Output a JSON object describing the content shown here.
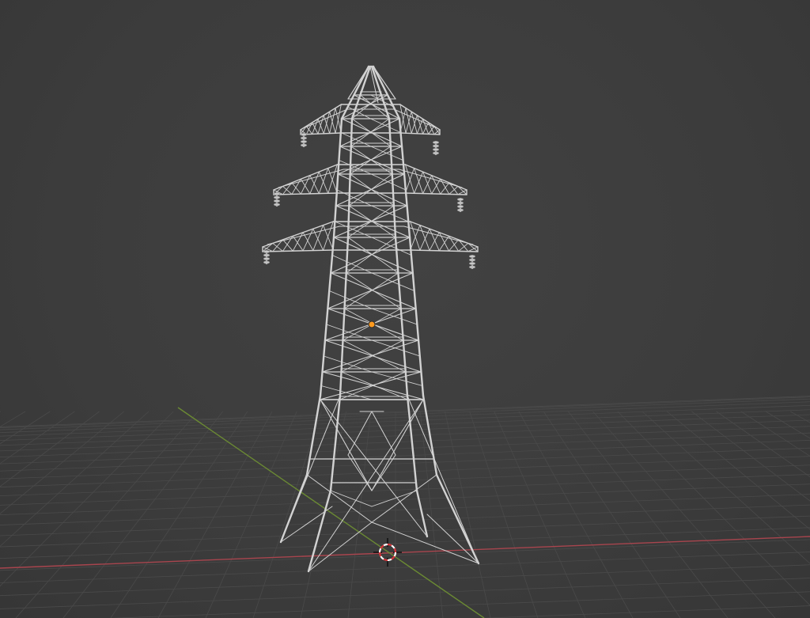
{
  "app": {
    "view": "3D Viewport",
    "shading": "wireframe"
  },
  "scene": {
    "background_color": "#3d3d3d",
    "grid_color": "#4a4a4a",
    "x_axis_color": "#a8454e",
    "y_axis_color": "#6b8a33",
    "wire_color": "#d2d2d2",
    "origin_color": "#ff9a1f"
  },
  "object": {
    "name_icon": "power-pylon-icon",
    "type": "lattice transmission tower",
    "crossarms": 3,
    "insulators": 6
  },
  "cursor": {
    "icon": "3d-cursor-icon"
  }
}
